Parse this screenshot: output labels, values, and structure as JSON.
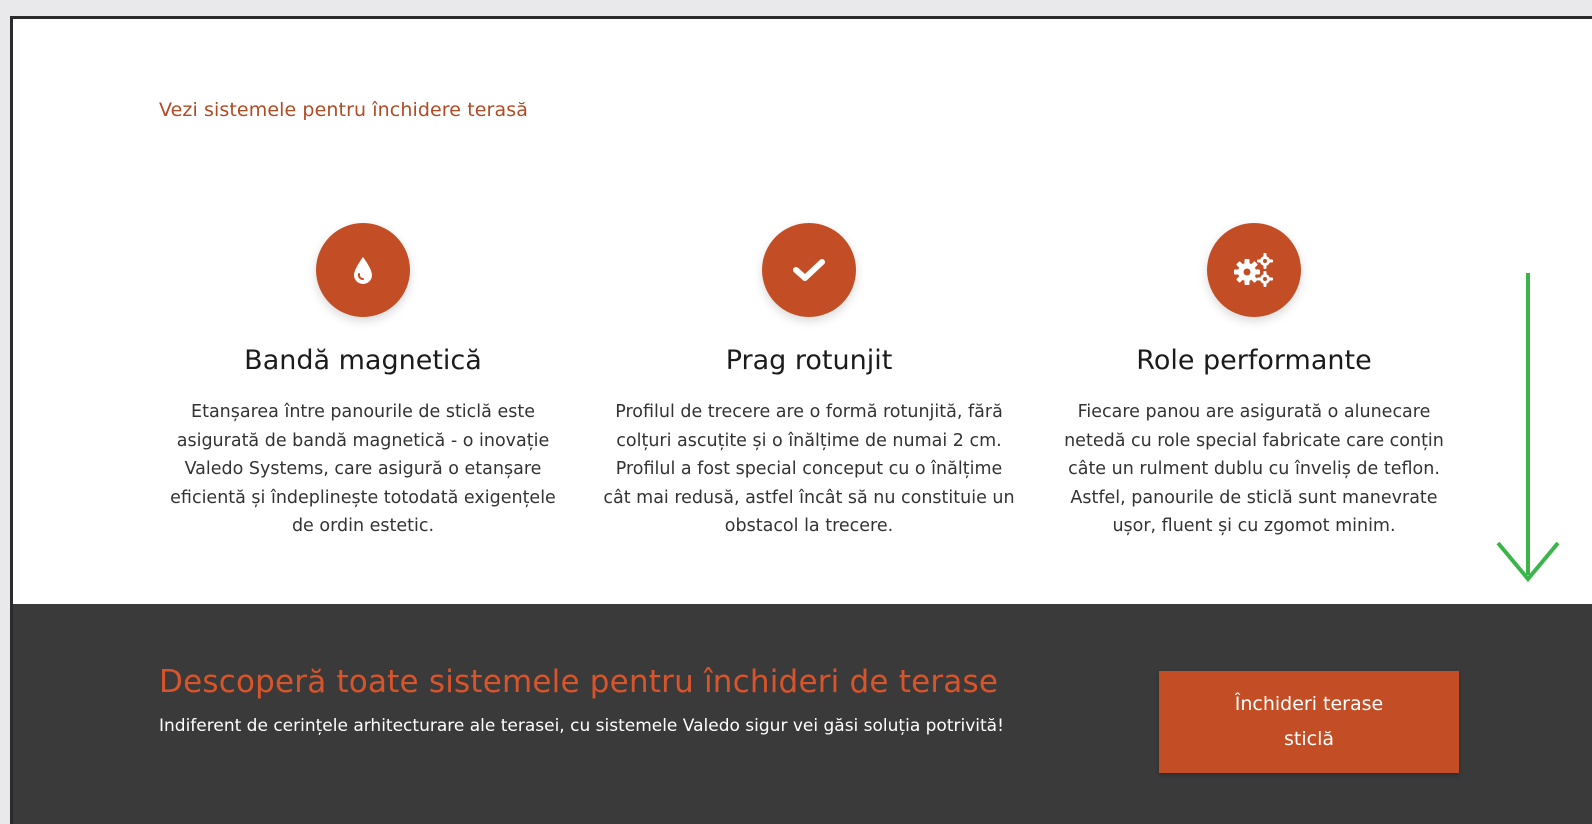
{
  "top_link": "Vezi sistemele pentru închidere terasă",
  "features": [
    {
      "icon": "drop-icon",
      "title": "Bandă magnetică",
      "text": "Etanșarea între panourile de sticlă este asigurată de bandă magnetică - o inovație Valedo Systems, care asigură o etanșare eficientă și îndeplinește totodată exigențele de ordin estetic."
    },
    {
      "icon": "check-icon",
      "title": "Prag rotunjit",
      "text": "Profilul de trecere are o formă rotunjită, fără colțuri ascuțite și o înălțime de numai 2 cm. Profilul a fost special conceput cu o înălțime cât mai redusă, astfel încât să nu constituie un obstacol la trecere."
    },
    {
      "icon": "gears-icon",
      "title": "Role performante",
      "text": "Fiecare panou are asigurată o alunecare netedă cu role special fabricate care conțin câte un rulment dublu cu înveliș de teflon. Astfel, panourile de sticlă sunt manevrate ușor, fluent și cu zgomot minim."
    }
  ],
  "cta_section": {
    "heading": "Descoperă toate sistemele pentru închideri de terase",
    "subtext": "Indiferent de cerințele arhitecturare ale terasei, cu sistemele Valedo sigur vei găsi soluția potrivită!",
    "button_label": "Închideri terase sticlă"
  },
  "colors": {
    "accent": "#c34d24",
    "dark_bg": "#3a3a3a",
    "arrow": "#3bb54a"
  }
}
